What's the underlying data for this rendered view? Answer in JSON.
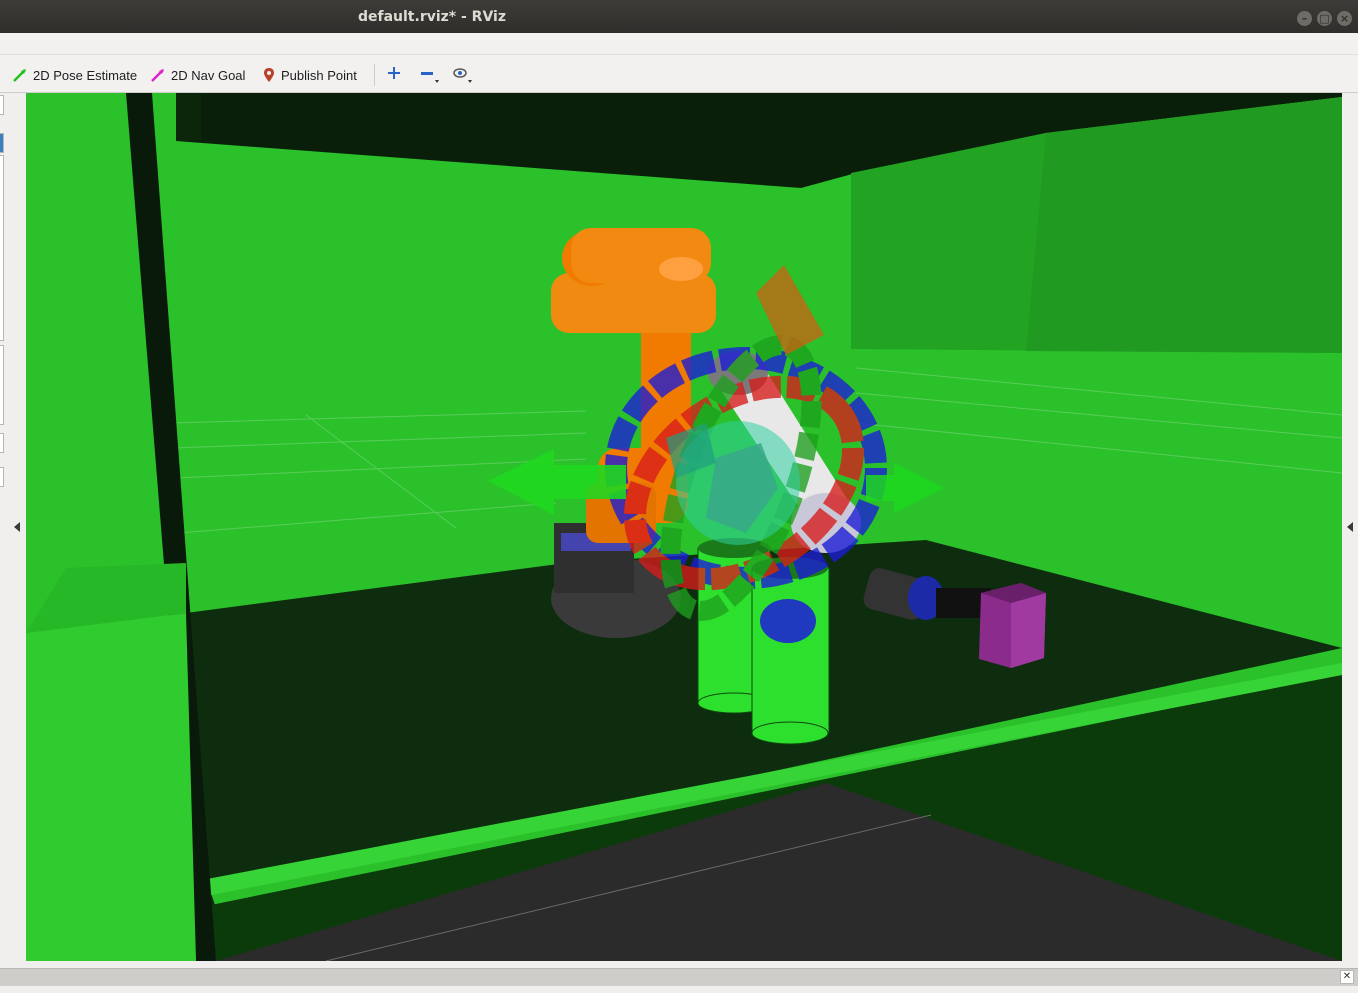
{
  "window": {
    "title": "default.rviz* - RViz"
  },
  "toolbar": {
    "pose_estimate_label": "2D Pose Estimate",
    "nav_goal_label": "2D Nav Goal",
    "publish_point_label": "Publish Point",
    "icons": [
      "zoom-in-icon",
      "zoom-out-icon",
      "camera-view-icon"
    ]
  },
  "colors": {
    "scene_green": "#2bc12b",
    "robot_orange": "#f07b00",
    "marker_blue": "#1c1cd8",
    "marker_red": "#d81c1c",
    "object_purple": "#8b2b8b"
  }
}
